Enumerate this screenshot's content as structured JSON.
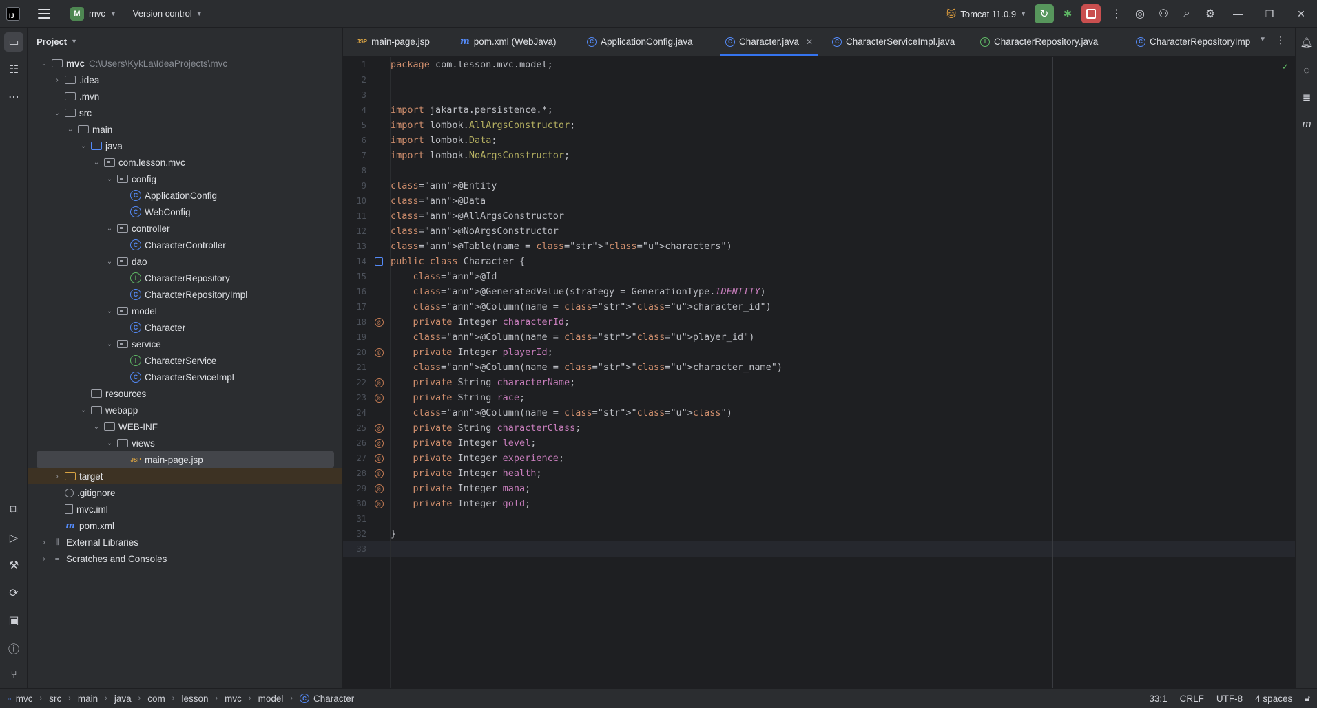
{
  "titlebar": {
    "logo": "IJ",
    "project_badge": "M",
    "project_name": "mvc",
    "version_control": "Version control",
    "run_config": "Tomcat 11.0.9",
    "icons": [
      "hamburger-menu-icon",
      "rerun-icon",
      "debug-icon",
      "stop-icon",
      "more-vertical-icon",
      "ai-assistant-icon",
      "add-user-icon",
      "search-icon",
      "settings-gear-icon"
    ]
  },
  "project_panel": {
    "title": "Project",
    "tree": [
      {
        "label": "mvc",
        "path": "C:\\Users\\KykLa\\IdeaProjects\\mvc",
        "icon": "folder-module",
        "expanded": true
      },
      {
        "label": ".idea",
        "icon": "folder",
        "expanded": false
      },
      {
        "label": ".mvn",
        "icon": "folder"
      },
      {
        "label": "src",
        "icon": "folder",
        "expanded": true
      },
      {
        "label": "main",
        "icon": "folder",
        "expanded": true
      },
      {
        "label": "java",
        "icon": "folder-source",
        "expanded": true
      },
      {
        "label": "com.lesson.mvc",
        "icon": "package",
        "expanded": true
      },
      {
        "label": "config",
        "icon": "package",
        "expanded": true
      },
      {
        "label": "ApplicationConfig",
        "icon": "class"
      },
      {
        "label": "WebConfig",
        "icon": "class"
      },
      {
        "label": "controller",
        "icon": "package",
        "expanded": true
      },
      {
        "label": "CharacterController",
        "icon": "class"
      },
      {
        "label": "dao",
        "icon": "package",
        "expanded": true
      },
      {
        "label": "CharacterRepository",
        "icon": "interface"
      },
      {
        "label": "CharacterRepositoryImpl",
        "icon": "class"
      },
      {
        "label": "model",
        "icon": "package",
        "expanded": true
      },
      {
        "label": "Character",
        "icon": "class"
      },
      {
        "label": "service",
        "icon": "package",
        "expanded": true
      },
      {
        "label": "CharacterService",
        "icon": "interface"
      },
      {
        "label": "CharacterServiceImpl",
        "icon": "class"
      },
      {
        "label": "resources",
        "icon": "folder"
      },
      {
        "label": "webapp",
        "icon": "folder",
        "expanded": true
      },
      {
        "label": "WEB-INF",
        "icon": "folder",
        "expanded": true
      },
      {
        "label": "views",
        "icon": "folder",
        "expanded": true
      },
      {
        "label": "main-page.jsp",
        "icon": "jsp",
        "selected": true
      },
      {
        "label": "target",
        "icon": "folder-excluded",
        "expanded": false
      },
      {
        "label": ".gitignore",
        "icon": "gitignore"
      },
      {
        "label": "mvc.iml",
        "icon": "file"
      },
      {
        "label": "pom.xml",
        "icon": "maven"
      },
      {
        "label": "External Libraries",
        "icon": "libraries",
        "expanded": false
      },
      {
        "label": "Scratches and Consoles",
        "icon": "scratches",
        "expanded": false
      }
    ]
  },
  "tabs": [
    {
      "label": "main-page.jsp",
      "icon": "JSP"
    },
    {
      "label": "pom.xml (WebJava)",
      "icon": "m"
    },
    {
      "label": "ApplicationConfig.java",
      "icon": "C"
    },
    {
      "label": "Character.java",
      "icon": "C",
      "active": true
    },
    {
      "label": "CharacterServiceImpl.java",
      "icon": "C"
    },
    {
      "label": "CharacterRepository.java",
      "icon": "I"
    },
    {
      "label": "CharacterRepositoryImp",
      "icon": "C"
    }
  ],
  "editor": {
    "line_count": 33,
    "current_line": 33,
    "lines": [
      "package com.lesson.mvc.model;",
      "",
      "",
      "import jakarta.persistence.*;",
      "import lombok.AllArgsConstructor;",
      "import lombok.Data;",
      "import lombok.NoArgsConstructor;",
      "",
      "@Entity",
      "@Data",
      "@AllArgsConstructor",
      "@NoArgsConstructor",
      "@Table(name = \"characters\")",
      "public class Character {",
      "    @Id",
      "    @GeneratedValue(strategy = GenerationType.IDENTITY)",
      "    @Column(name = \"character_id\")",
      "    private Integer characterId;",
      "    @Column(name = \"player_id\")",
      "    private Integer playerId;",
      "    @Column(name = \"character_name\")",
      "    private String characterName;",
      "    private String race;",
      "    @Column(name = \"class\")",
      "    private String characterClass;",
      "    private Integer level;",
      "    private Integer experience;",
      "    private Integer health;",
      "    private Integer mana;",
      "    private Integer gold;",
      "",
      "}",
      ""
    ]
  },
  "statusbar": {
    "breadcrumbs": [
      "mvc",
      "src",
      "main",
      "java",
      "com",
      "lesson",
      "mvc",
      "model",
      "Character"
    ],
    "position": "33:1",
    "line_separator": "CRLF",
    "encoding": "UTF-8",
    "indent": "4 spaces"
  },
  "colors": {
    "accent": "#3574f0",
    "run_green": "#57965c",
    "stop_red": "#c94f4f",
    "keyword": "#cf8e6d",
    "annotation": "#b3ae60",
    "string": "#6aab73",
    "field": "#c77dbb"
  }
}
